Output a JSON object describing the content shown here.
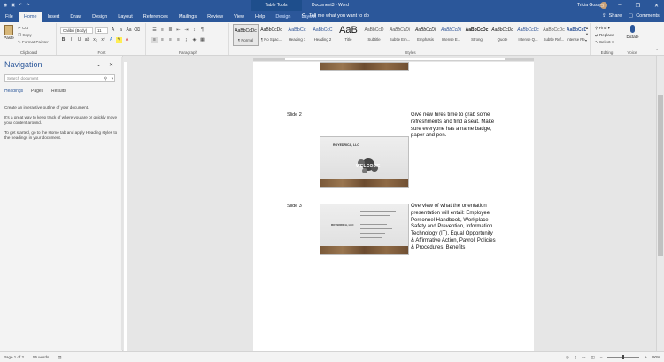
{
  "titlebar": {
    "context_tab": "Table Tools",
    "document_title": "Document3 - Word",
    "user": "Tricia Goss"
  },
  "tabs": [
    "File",
    "Home",
    "Insert",
    "Draw",
    "Design",
    "Layout",
    "References",
    "Mailings",
    "Review",
    "View",
    "Help",
    "Design",
    "Layout"
  ],
  "active_tab": "Home",
  "tell_me": "Tell me what you want to do",
  "share_label": "Share",
  "comments_label": "Comments",
  "ribbon": {
    "clipboard": {
      "paste": "Paste",
      "cut": "Cut",
      "copy": "Copy",
      "format_painter": "Format Painter",
      "name": "Clipboard"
    },
    "font": {
      "family": "Calibri (Body)",
      "size": "11",
      "name": "Font"
    },
    "paragraph": {
      "name": "Paragraph"
    },
    "styles": {
      "name": "Styles",
      "items": [
        {
          "sample": "AaBbCcDc",
          "name": "¶ Normal"
        },
        {
          "sample": "AaBbCcDc",
          "name": "¶ No Spac..."
        },
        {
          "sample": "AaBbCc",
          "name": "Heading 1"
        },
        {
          "sample": "AaBbCcC",
          "name": "Heading 2"
        },
        {
          "sample": "AaB",
          "name": "Title"
        },
        {
          "sample": "AaBbCcD",
          "name": "Subtitle"
        },
        {
          "sample": "AaBbCcDi",
          "name": "Subtle Em..."
        },
        {
          "sample": "AaBbCcDi",
          "name": "Emphasis"
        },
        {
          "sample": "AaBbCcDi",
          "name": "Intense E..."
        },
        {
          "sample": "AaBbCcDc",
          "name": "Strong"
        },
        {
          "sample": "AaBbCcDc",
          "name": "Quote"
        },
        {
          "sample": "AaBbCcDc",
          "name": "Intense Q..."
        },
        {
          "sample": "AaBbCcDc",
          "name": "Subtle Ref..."
        },
        {
          "sample": "AaBbCcDc",
          "name": "Intense Re..."
        }
      ]
    },
    "editing": {
      "find": "Find",
      "replace": "Replace",
      "select": "Select",
      "name": "Editing"
    },
    "voice": {
      "dictate": "Dictate",
      "name": "Voice"
    }
  },
  "navigation": {
    "title": "Navigation",
    "search_placeholder": "Search document",
    "tabs": [
      "Headings",
      "Pages",
      "Results"
    ],
    "active_tab": "Headings",
    "help": [
      "Create an interactive outline of your document.",
      "It's a great way to keep track of where you are or quickly move your content around.",
      "To get started, go to the Home tab and apply Heading styles to the headings in your document."
    ]
  },
  "document": {
    "slides": [
      {
        "label": "Slide 2",
        "slide_title": "ROYEDRICA, LLC",
        "slide_graphic_word": "WELCOME",
        "note": "Give new hires time to grab some refreshments and find a seat. Make sure everyone has a name badge, paper and pen."
      },
      {
        "label": "Slide 3",
        "slide_title": "ROYEDRICA, LLC",
        "note": "Overview of what the orientation presentation will entail: Employee Personnel Handbook, Workplace Safety and Prevention, Information Technology (IT), Equal Opportunity & Affirmative Action, Payroll Policies & Procedures, Benefits"
      }
    ]
  },
  "status": {
    "page": "Page 1 of 2",
    "words": "56 words",
    "zoom": "90%"
  },
  "colors": {
    "brand": "#2b579a",
    "wood": "#7b5a3a"
  }
}
